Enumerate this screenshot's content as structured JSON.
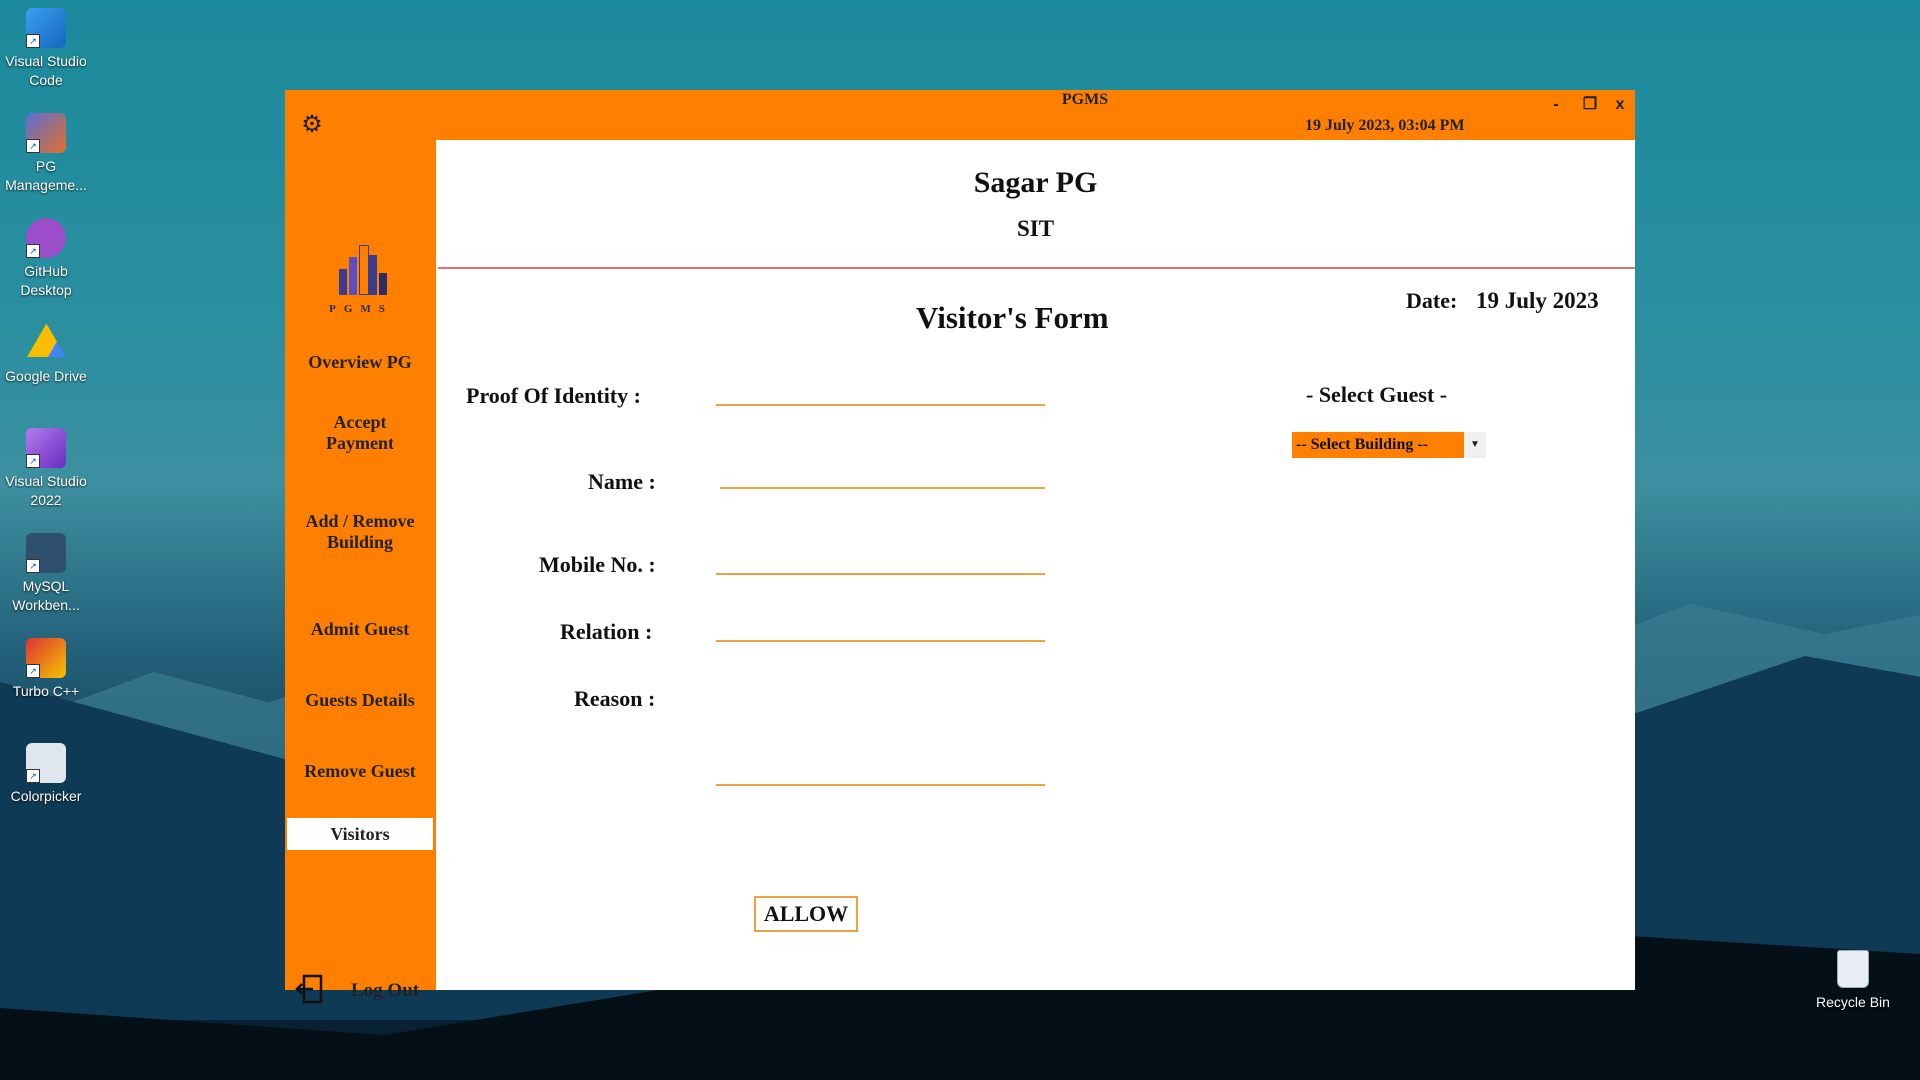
{
  "desktop": {
    "icons": [
      {
        "label_line1": "Visual Studio",
        "label_line2": "Code"
      },
      {
        "label_line1": "PG",
        "label_line2": "Manageme..."
      },
      {
        "label_line1": "GitHub",
        "label_line2": "Desktop"
      },
      {
        "label_line1": "Google Drive",
        "label_line2": ""
      },
      {
        "label_line1": "Visual Studio",
        "label_line2": "2022"
      },
      {
        "label_line1": "MySQL",
        "label_line2": "Workben..."
      },
      {
        "label_line1": "Turbo C++",
        "label_line2": ""
      },
      {
        "label_line1": "Colorpicker",
        "label_line2": ""
      }
    ],
    "recycle_bin": "Recycle Bin"
  },
  "window": {
    "title": "PGMS",
    "datetime": "19 July 2023,  03:04 PM",
    "controls": {
      "minimize": "-",
      "maximize": "❐",
      "close": "x"
    },
    "accent": "#ff8000"
  },
  "sidebar": {
    "logo_text": "PGMS",
    "items": [
      {
        "label": "Overview PG"
      },
      {
        "label": "Accept Payment"
      },
      {
        "label": "Add / Remove Building"
      },
      {
        "label": "Admit Guest"
      },
      {
        "label": "Guests Details"
      },
      {
        "label": "Remove Guest"
      },
      {
        "label": "Visitors",
        "active": true
      }
    ],
    "logout": "Log Out"
  },
  "main": {
    "pg_name": "Sagar PG",
    "pg_subtitle": "SIT",
    "date_label": "Date:",
    "date_value": "19 July 2023",
    "form_title": "Visitor's Form",
    "fields": {
      "proof": {
        "label": "Proof Of Identity :",
        "value": ""
      },
      "name": {
        "label": "Name :",
        "value": ""
      },
      "mobile": {
        "label": "Mobile No. :",
        "value": ""
      },
      "relation": {
        "label": "Relation :",
        "value": ""
      },
      "reason": {
        "label": "Reason :",
        "value": ""
      }
    },
    "select_guest": "- Select Guest -",
    "building_dropdown": "-- Select Building --",
    "allow_button": "ALLOW"
  }
}
